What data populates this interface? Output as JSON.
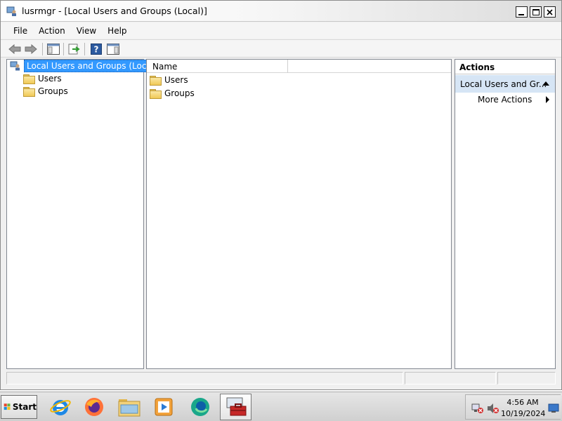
{
  "window": {
    "title": "lusrmgr - [Local Users and Groups (Local)]"
  },
  "menu": [
    "File",
    "Action",
    "View",
    "Help"
  ],
  "toolbar": {
    "buttons": [
      "back-icon",
      "forward-icon",
      "show-hide-console-tree-icon",
      "export-list-icon",
      "help-icon",
      "show-hide-action-pane-icon"
    ]
  },
  "tree": {
    "root": "Local Users and Groups (Local)",
    "children": [
      "Users",
      "Groups"
    ]
  },
  "list": {
    "columns": [
      "Name",
      ""
    ],
    "rows": [
      "Users",
      "Groups"
    ]
  },
  "actions": {
    "title": "Actions",
    "section": "Local Users and Gr...",
    "items": [
      "More Actions"
    ]
  },
  "taskbar": {
    "start_label": "Start",
    "apps": [
      "internet-explorer-icon",
      "firefox-icon",
      "file-explorer-icon",
      "media-player-icon",
      "edge-icon",
      "computer-management-icon"
    ],
    "time": "4:56 AM",
    "date": "10/19/2024"
  },
  "colors": {
    "selection": "#3399ff",
    "actions_section": "#d6e5f5",
    "folder": "#f0c956"
  }
}
